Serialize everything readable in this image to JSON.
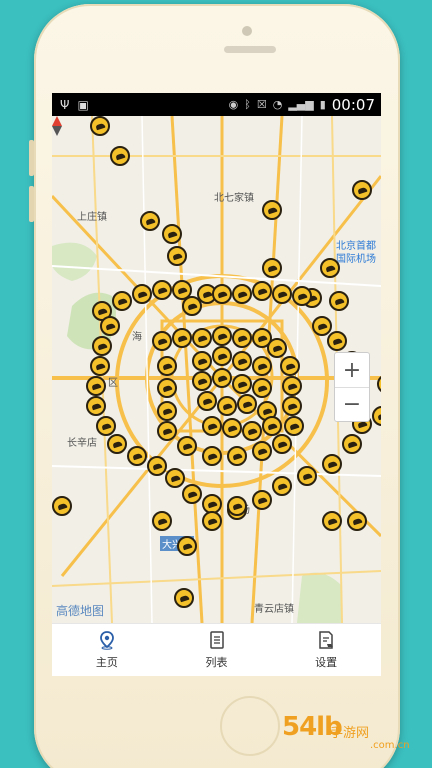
{
  "status_bar": {
    "time": "00:07"
  },
  "map": {
    "places": [
      {
        "name": "北七家镇",
        "style": ""
      },
      {
        "name": "上庄镇",
        "style": ""
      },
      {
        "name": "北京首都",
        "style": "blue"
      },
      {
        "name": "国际机场",
        "style": "blue"
      },
      {
        "name": "海",
        "style": ""
      },
      {
        "name": "区",
        "style": ""
      },
      {
        "name": "长辛店",
        "style": ""
      },
      {
        "name": "机场",
        "style": ""
      },
      {
        "name": "青云店镇",
        "style": ""
      }
    ],
    "district_label": "大兴区",
    "logo": "高德地图"
  },
  "zoom": {
    "in_label": "+",
    "out_label": "−"
  },
  "tabs": [
    {
      "label": "主页",
      "icon": "location-pin-icon",
      "active": true
    },
    {
      "label": "列表",
      "icon": "list-document-icon",
      "active": false
    },
    {
      "label": "设置",
      "icon": "settings-document-icon",
      "active": false
    }
  ],
  "watermark": {
    "text": "54lb",
    "sub": "手游网",
    "domain": ".com.cn"
  },
  "colors": {
    "background": "#3bbfbf",
    "marker": "#f4c12b",
    "road": "#f7c04a"
  }
}
